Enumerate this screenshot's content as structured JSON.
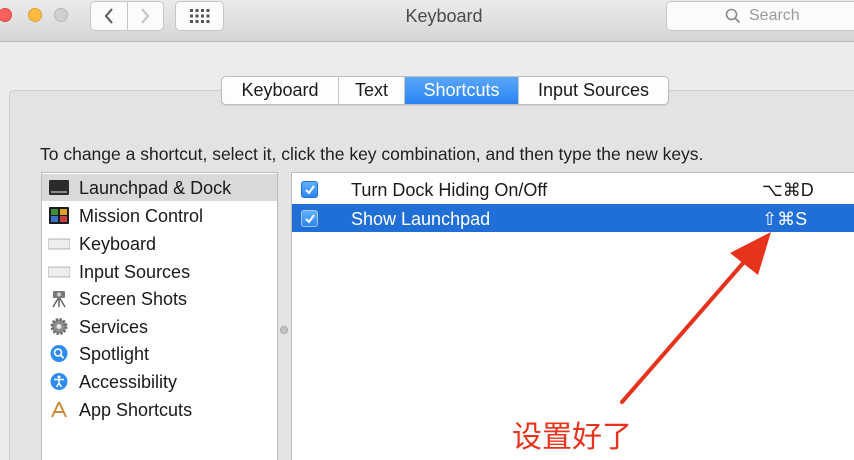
{
  "window": {
    "title": "Keyboard"
  },
  "search": {
    "placeholder": "Search"
  },
  "tabs": [
    {
      "label": "Keyboard",
      "active": false
    },
    {
      "label": "Text",
      "active": false
    },
    {
      "label": "Shortcuts",
      "active": true
    },
    {
      "label": "Input Sources",
      "active": false
    }
  ],
  "instructions": "To change a shortcut, select it, click the key combination, and then type the new keys.",
  "sidebar": {
    "items": [
      {
        "label": "Launchpad & Dock",
        "icon": "launchpad-dock-icon",
        "selected": true
      },
      {
        "label": "Mission Control",
        "icon": "mission-control-icon",
        "selected": false
      },
      {
        "label": "Keyboard",
        "icon": "keyboard-icon",
        "selected": false
      },
      {
        "label": "Input Sources",
        "icon": "input-sources-icon",
        "selected": false
      },
      {
        "label": "Screen Shots",
        "icon": "screen-shots-icon",
        "selected": false
      },
      {
        "label": "Services",
        "icon": "services-gear-icon",
        "selected": false
      },
      {
        "label": "Spotlight",
        "icon": "spotlight-icon",
        "selected": false
      },
      {
        "label": "Accessibility",
        "icon": "accessibility-icon",
        "selected": false
      },
      {
        "label": "App Shortcuts",
        "icon": "app-shortcuts-icon",
        "selected": false
      }
    ]
  },
  "shortcuts": [
    {
      "label": "Turn Dock Hiding On/Off",
      "keys": "⌥⌘D",
      "checked": true,
      "selected": false
    },
    {
      "label": "Show Launchpad",
      "keys": "⇧⌘S",
      "checked": true,
      "selected": true
    }
  ],
  "annotation": {
    "text": "设置好了",
    "color": "#e8331c"
  },
  "colors": {
    "accent": "#2a83f2",
    "selection": "#1f6fd6"
  }
}
